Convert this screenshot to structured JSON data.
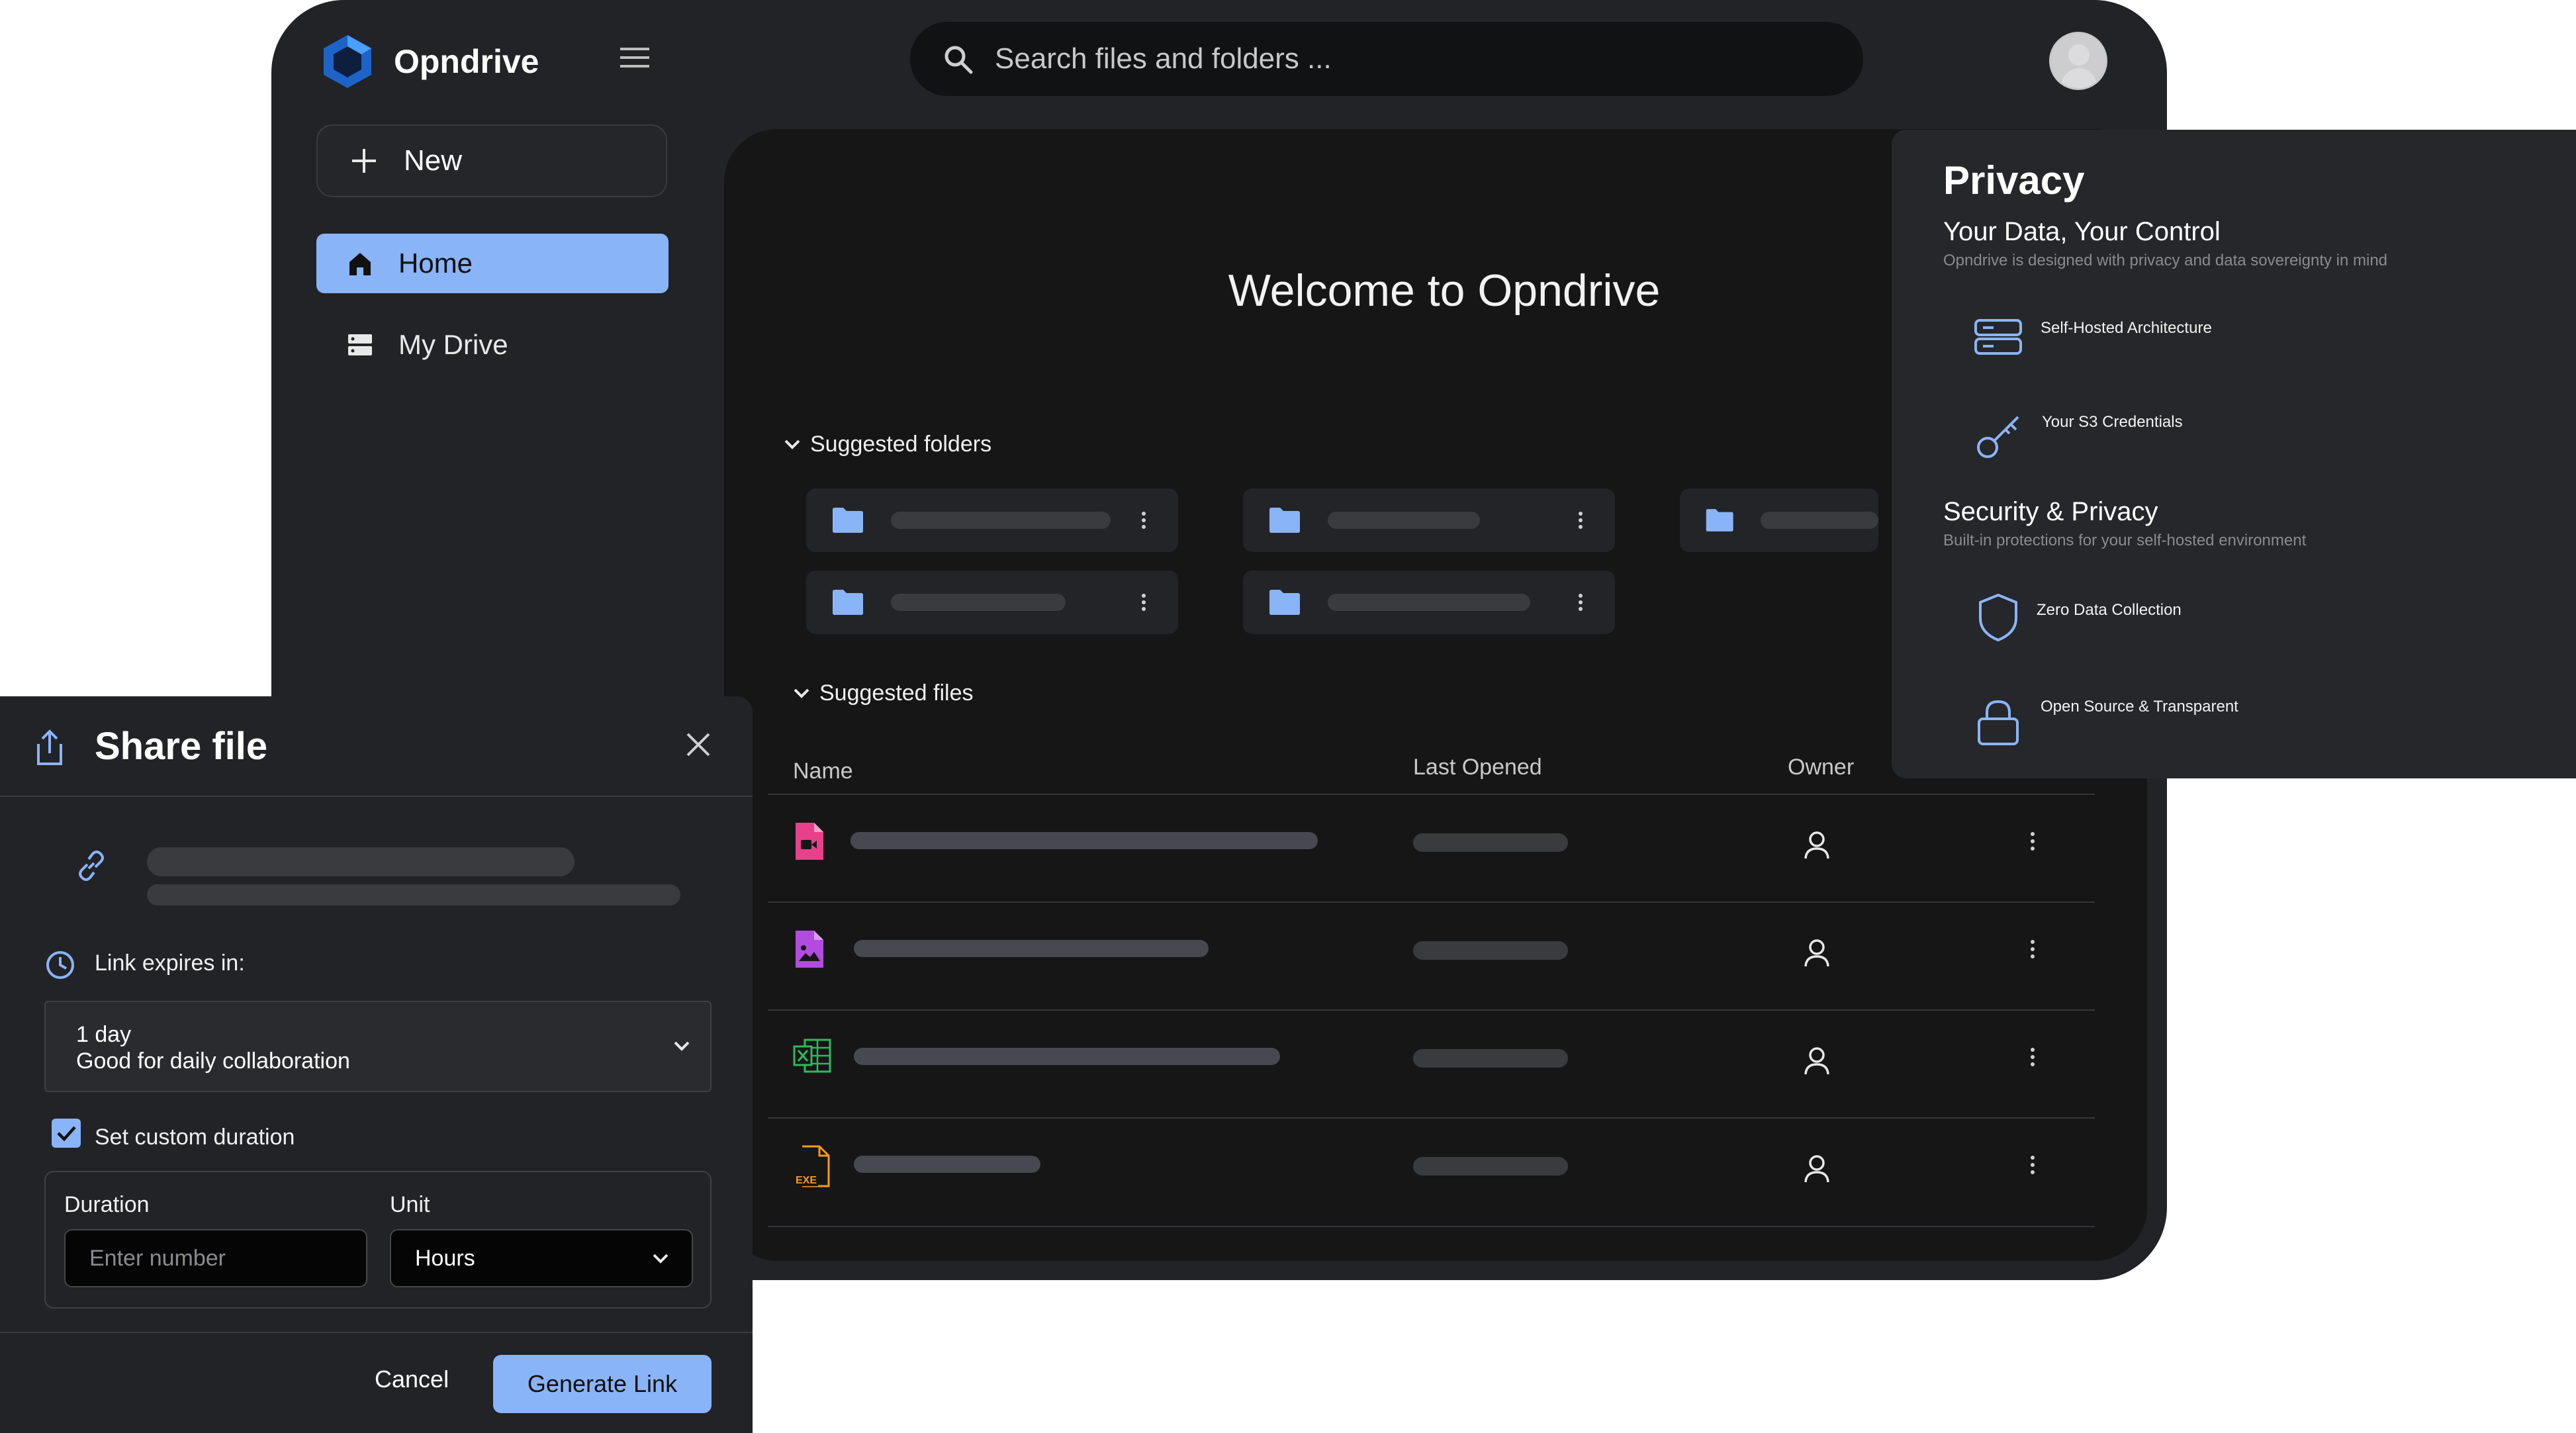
{
  "app": {
    "name": "Opndrive"
  },
  "sidebar": {
    "new_label": "New",
    "items": [
      {
        "label": "Home",
        "icon": "home-icon",
        "active": true
      },
      {
        "label": "My Drive",
        "icon": "drive-icon",
        "active": false
      }
    ]
  },
  "search": {
    "placeholder": "Search files and folders ..."
  },
  "main": {
    "welcome": "Welcome to Opndrive",
    "suggested_folders": "Suggested folders",
    "suggested_files": "Suggested files",
    "columns": {
      "name": "Name",
      "last_opened": "Last Opened",
      "owner": "Owner"
    },
    "file_icons": [
      "video-file-icon",
      "image-file-icon",
      "spreadsheet-file-icon",
      "exe-file-icon"
    ],
    "exe_label": "EXE"
  },
  "privacy": {
    "title": "Privacy",
    "section1_title": "Your Data, Your Control",
    "section1_sub": "Opndrive is designed with privacy and data sovereignty in mind",
    "feature1": "Self-Hosted Architecture",
    "feature2": "Your S3 Credentials",
    "section2_title": "Security & Privacy",
    "section2_sub": "Built-in protections for your self-hosted environment",
    "feature3": "Zero Data Collection",
    "feature4": "Open Source & Transparent"
  },
  "share": {
    "title": "Share file",
    "expires_label": "Link expires in:",
    "selected_option": "1 day",
    "selected_desc": "Good for daily collaboration",
    "custom_label": "Set custom duration",
    "custom_checked": true,
    "duration_label": "Duration",
    "duration_placeholder": "Enter number",
    "unit_label": "Unit",
    "unit_value": "Hours",
    "cancel": "Cancel",
    "generate": "Generate Link"
  },
  "colors": {
    "accent": "#8ab4f8",
    "background": "#222326",
    "panel": "#161616"
  }
}
